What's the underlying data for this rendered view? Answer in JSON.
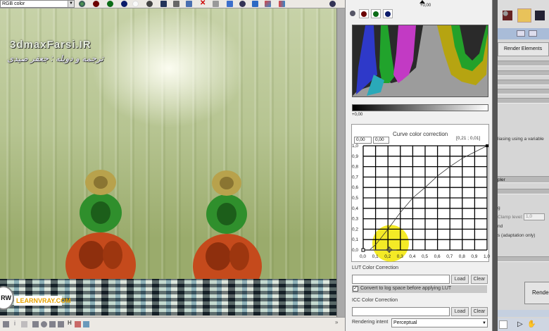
{
  "toolbar": {
    "channel_select": "RGB color",
    "icons": [
      "rgb-channel-icon",
      "red-channel-icon",
      "green-channel-icon",
      "blue-channel-icon",
      "alpha-channel-icon",
      "monochrome-icon",
      "save-icon",
      "clone-icon",
      "load-icon",
      "clear-icon",
      "link-icon",
      "region-render-icon",
      "render-teapot-icon",
      "lens-effects-icon",
      "history-icon",
      "ab-compare-icon",
      "teapot-icon"
    ],
    "colors": {
      "red": "#6b0000",
      "green": "#0b6b16",
      "blue": "#0a1a6a"
    }
  },
  "render": {
    "watermark_site": "3dmaxFarsi.IR",
    "watermark_credit": "ترجمه و دوبله : جعفر صیدی",
    "logo_text": "LEARNVRAY.COM",
    "logo_badge": "RW"
  },
  "color_correction": {
    "exposure_marker": "+0,00",
    "histogram_black_point": "+0,00",
    "curve": {
      "title": "Curve color correction",
      "input_x": "0,00",
      "input_y": "0,00",
      "cursor_readout": "[0,21 ; 0,01]",
      "y_ticks": [
        "0,0",
        "0,1",
        "0,2",
        "0,3",
        "0,4",
        "0,5",
        "0,6",
        "0,7",
        "0,8",
        "0,9",
        "1,0"
      ],
      "x_ticks": [
        "0,0",
        "0,1",
        "0,2",
        "0,3",
        "0,4",
        "0,5",
        "0,6",
        "0,7",
        "0,8",
        "0,9",
        "1,0"
      ],
      "points": [
        [
          0,
          0
        ],
        [
          0.05,
          0
        ],
        [
          0.1,
          0.05
        ],
        [
          0.2,
          0.2
        ],
        [
          0.3,
          0.36
        ],
        [
          0.4,
          0.5
        ],
        [
          0.5,
          0.6
        ],
        [
          0.6,
          0.71
        ],
        [
          0.7,
          0.8
        ],
        [
          0.8,
          0.88
        ],
        [
          0.9,
          0.94
        ],
        [
          1,
          1
        ]
      ],
      "highlight_color": "#f2e600"
    },
    "lut": {
      "label": "LUT Color Correction",
      "value": "",
      "load": "Load",
      "clear": "Clear",
      "log_checkbox": "Convert to log space before applying LUT",
      "log_checked": true
    },
    "icc": {
      "label": "ICC Color Correction",
      "value": "",
      "load": "Load",
      "clear": "Clear",
      "intent_label": "Rendering intent",
      "intent_value": "Perceptual"
    }
  },
  "right_panel": {
    "tab": "Render Elements",
    "text1": "liasing using a variable",
    "text2": "pler",
    "clamp_label": "Clamp level:",
    "clamp_value": "1,0",
    "text3": "nd",
    "text4": "s (adaptation only)",
    "render_button": "Rende"
  }
}
